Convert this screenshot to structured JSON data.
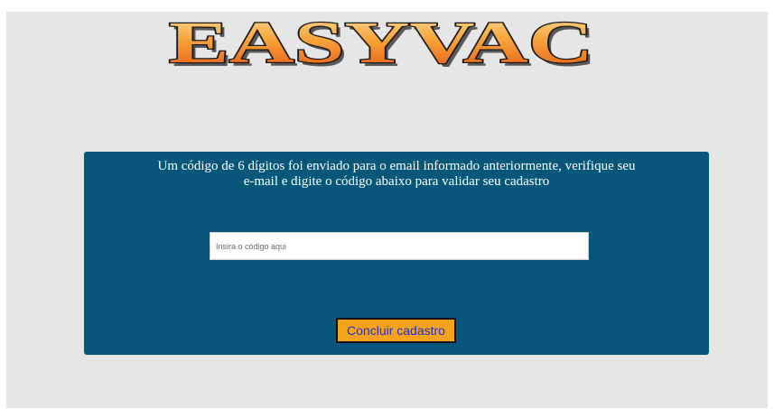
{
  "logo": {
    "text": "EASYVAC",
    "colors": {
      "fill_top": "#fde19a",
      "fill_bottom": "#e85412",
      "stroke": "#1a1a1a",
      "shadow": "#2b2b2b"
    }
  },
  "panel": {
    "message_line1": "Um código de 6 dígitos foi enviado para o email informado anteriormente, verifique seu",
    "message_line2": "e-mail e digite o código abaixo para validar seu cadastro",
    "background_color": "#06577a"
  },
  "code_input": {
    "placeholder": "Insira o código aqui",
    "value": ""
  },
  "submit_button": {
    "label": "Concluir cadastro",
    "background_color": "#f4a31a",
    "text_color": "#1f2fd6"
  },
  "page": {
    "background_color": "#e6e6e6"
  }
}
